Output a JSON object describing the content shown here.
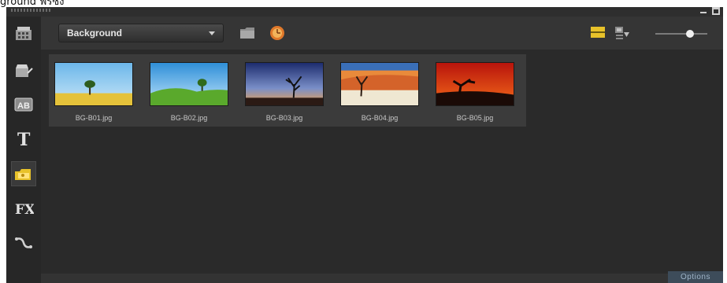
{
  "caption": {
    "text": "ground ฟรีซิ่ง"
  },
  "window": {
    "minimize_icon": "minimize-icon",
    "restore_icon": "restore-icon"
  },
  "sidebar": {
    "items": [
      {
        "name": "media",
        "icon": "film-strip-icon",
        "active": false
      },
      {
        "name": "instant-project",
        "icon": "clapper-wand-icon",
        "active": false
      },
      {
        "name": "transition",
        "icon": "ab-transition-icon",
        "label": "AB",
        "active": false
      },
      {
        "name": "title",
        "icon": "title-t-icon",
        "label": "T",
        "active": false
      },
      {
        "name": "graphic",
        "icon": "graphic-folder-icon",
        "active": true
      },
      {
        "name": "filter",
        "icon": "fx-icon",
        "label": "FX",
        "active": false
      },
      {
        "name": "path",
        "icon": "motion-path-icon",
        "active": false
      }
    ]
  },
  "toolbar": {
    "category_selected": "Background",
    "browse_icon": "folder-icon",
    "color_icon": "color-clock-icon",
    "list_view_icon": "list-view-icon",
    "sort_icon": "sort-import-icon",
    "zoom_level": 0.7
  },
  "library": {
    "items": [
      {
        "label": "BG-B01.jpg",
        "scene": "tree-yellow-field"
      },
      {
        "label": "BG-B02.jpg",
        "scene": "green-hills-tree"
      },
      {
        "label": "BG-B03.jpg",
        "scene": "dusk-bare-tree"
      },
      {
        "label": "BG-B04.jpg",
        "scene": "desert-dead-tree"
      },
      {
        "label": "BG-B05.jpg",
        "scene": "red-sunset-tree"
      }
    ]
  },
  "footer": {
    "options_label": "Options"
  },
  "colors": {
    "accent_yellow": "#e8c22a",
    "panel": "#2e2e2e",
    "options_bg": "#3d4c5a"
  }
}
